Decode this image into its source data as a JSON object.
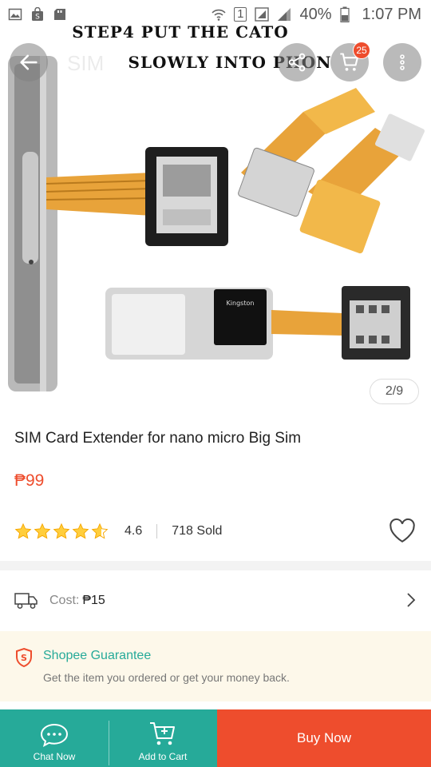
{
  "status_bar": {
    "battery": "40%",
    "time": "1:07 PM",
    "notification_badge": "1"
  },
  "hero": {
    "caption_line1": "STEP4 PUT THE CATO",
    "caption_line2": "SLOWLY INTO PHON",
    "faded_title": "SIM",
    "page_indicator": "2/9",
    "cart_count": "25"
  },
  "product": {
    "title": "SIM Card Extender for nano micro Big Sim",
    "price": "₱99",
    "rating": "4.6",
    "rating_value": 4.6,
    "sold": "718 Sold"
  },
  "shipping": {
    "cost_label": "Cost:",
    "cost_value": "₱15"
  },
  "guarantee": {
    "title": "Shopee Guarantee",
    "description": "Get the item you ordered or get your money back."
  },
  "bottom_bar": {
    "chat_label": "Chat Now",
    "add_to_cart_label": "Add to Cart",
    "buy_now_label": "Buy Now"
  },
  "colors": {
    "brand_orange": "#ee4d2d",
    "teal": "#26aa99",
    "star": "#ffce3d",
    "guarantee_bg": "#fdf8ea"
  },
  "icons": [
    "image-icon",
    "shopping-bag-icon",
    "photo-sd-icon",
    "wifi-icon",
    "signal-icon",
    "battery-icon",
    "back-arrow-icon",
    "share-icon",
    "cart-icon",
    "more-vertical-icon",
    "star-icon",
    "heart-icon",
    "truck-icon",
    "chevron-right-icon",
    "shield-icon",
    "chat-icon",
    "add-to-cart-icon"
  ]
}
